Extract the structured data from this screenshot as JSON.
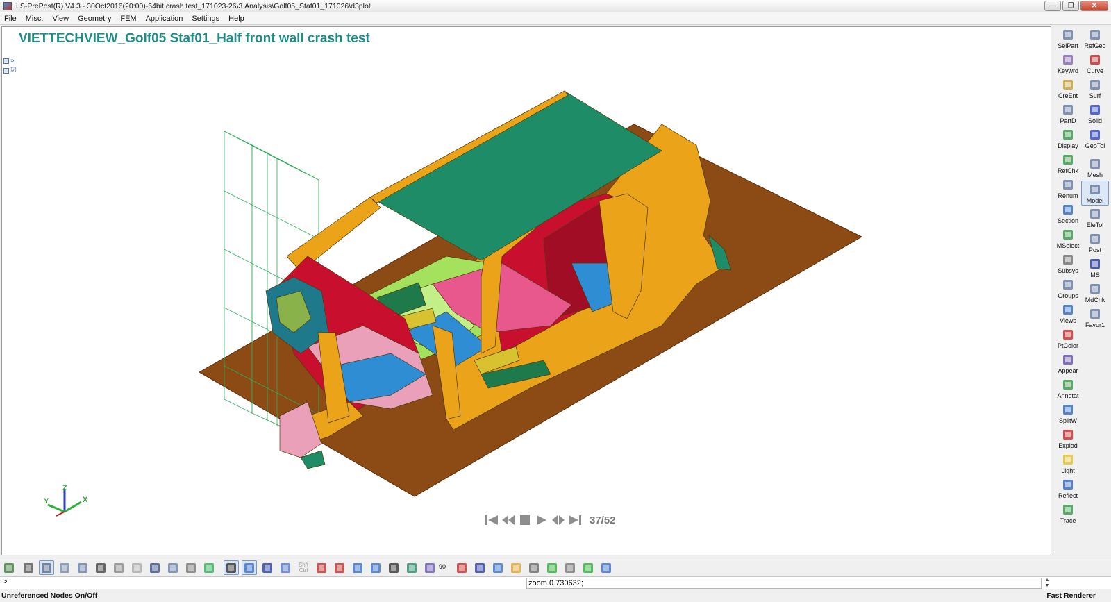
{
  "window": {
    "title": "LS-PrePost(R) V4.3 - 30Oct2016(20:00)-64bit  crash test_171023-26\\3.Analysis\\Golf05_Staf01_171026\\d3plot",
    "min_label": "—",
    "max_label": "❐",
    "close_label": "✕"
  },
  "menu": [
    "File",
    "Misc.",
    "View",
    "Geometry",
    "FEM",
    "Application",
    "Settings",
    "Help"
  ],
  "viewport": {
    "title": "VIETTECHVIEW_Golf05 Staf01_Half front wall crash test",
    "axis_labels": {
      "x": "X",
      "y": "Y",
      "z": "Z"
    }
  },
  "animation": {
    "frame": "37/52"
  },
  "right_toolbar": {
    "left_column": [
      {
        "label": "SelPart",
        "icon": "select-part-icon",
        "color": "#6b7fa8"
      },
      {
        "label": "Keywrd",
        "icon": "keyword-icon",
        "color": "#8a6bb0"
      },
      {
        "label": "CreEnt",
        "icon": "create-entity-icon",
        "color": "#c9a33a"
      },
      {
        "label": "PartD",
        "icon": "part-data-icon",
        "color": "#6b7fa8"
      },
      {
        "label": "Display",
        "icon": "display-icon",
        "color": "#3c9c4c"
      },
      {
        "label": "RefChk",
        "icon": "reference-check-icon",
        "color": "#3c9c4c"
      },
      {
        "label": "Renum",
        "icon": "renumber-icon",
        "color": "#6b7fa8"
      },
      {
        "label": "Section",
        "icon": "section-icon",
        "color": "#3a6fc9"
      },
      {
        "label": "MSelect",
        "icon": "multi-select-icon",
        "color": "#3c9c4c"
      },
      {
        "label": "Subsys",
        "icon": "subsystem-icon",
        "color": "#777777"
      },
      {
        "label": "Groups",
        "icon": "groups-icon",
        "color": "#6b7fa8"
      },
      {
        "label": "Views",
        "icon": "views-icon",
        "color": "#3a6fc9"
      },
      {
        "label": "PtColor",
        "icon": "part-color-icon",
        "color": "#d03030"
      },
      {
        "label": "Appear",
        "icon": "appearance-icon",
        "color": "#6b58b0"
      },
      {
        "label": "Annotat",
        "icon": "annotation-icon",
        "color": "#3c9c4c"
      },
      {
        "label": "SplitW",
        "icon": "split-window-icon",
        "color": "#3a6fc9"
      },
      {
        "label": "Explod",
        "icon": "explode-icon",
        "color": "#d03030"
      },
      {
        "label": "Light",
        "icon": "light-icon",
        "color": "#e2c530"
      },
      {
        "label": "Reflect",
        "icon": "reflect-icon",
        "color": "#3a6fc9"
      },
      {
        "label": "Trace",
        "icon": "trace-icon",
        "color": "#3c9c4c"
      }
    ],
    "right_column": [
      {
        "label": "RefGeo",
        "icon": "reference-geometry-icon",
        "color": "#6b7fa8"
      },
      {
        "label": "Curve",
        "icon": "curve-icon",
        "color": "#c03030"
      },
      {
        "label": "Surf",
        "icon": "surface-icon",
        "color": "#6b7fa8"
      },
      {
        "label": "Solid",
        "icon": "solid-icon",
        "color": "#3a4fc9"
      },
      {
        "label": "GeoTol",
        "icon": "geometry-tool-icon",
        "color": "#3a4fc9"
      },
      {
        "label": "Mesh",
        "icon": "mesh-icon",
        "color": "#6b7fa8"
      },
      {
        "label": "Model",
        "icon": "model-icon",
        "color": "#6b7fa8"
      },
      {
        "label": "EleTol",
        "icon": "element-tool-icon",
        "color": "#6b7fa8"
      },
      {
        "label": "Post",
        "icon": "post-icon",
        "color": "#6b7fa8"
      },
      {
        "label": "MS",
        "icon": "ms-icon",
        "color": "#2a3fa0"
      },
      {
        "label": "MdChk",
        "icon": "model-check-icon",
        "color": "#6b7fa8"
      },
      {
        "label": "Favor1",
        "icon": "favorite-icon",
        "color": "#6b7fa8"
      }
    ],
    "renum_caption": "Renum"
  },
  "bottom_toolbar": {
    "shft_ctrl": "Shft\nCtrl",
    "angle": "90",
    "items": [
      "home-icon",
      "wireframe-cube-icon",
      "shaded-cube-icon",
      "hidden-cube-icon",
      "mesh-cube-icon",
      "outline-cube-icon",
      "edge-cube-icon",
      "dots-cube-icon",
      "grid-cube-icon",
      "shrink-cube-icon",
      "node-cube-icon",
      "fringe-icon",
      "u-toggle-icon",
      "solid-view-icon",
      "blue-box-icon",
      "perspective-icon",
      "shift-ctrl-icon",
      "pick-icon",
      "center-icon",
      "zoom-icon",
      "zoom-window-icon",
      "rotate-icon",
      "globe-icon",
      "orient-icon",
      "axis-icon",
      "cube-blue-icon",
      "house-icon",
      "lightning-icon",
      "checker-icon",
      "play-green-icon",
      "gears-icon",
      "gear-green-icon",
      "image-icon"
    ]
  },
  "command": {
    "prompt": ">",
    "value": "zoom 0.730632;"
  },
  "status": {
    "left": "Unreferenced Nodes On/Off",
    "right": "Fast Renderer"
  }
}
